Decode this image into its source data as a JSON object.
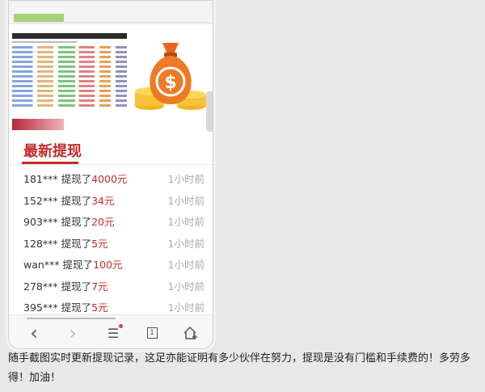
{
  "section_title": "最新提现",
  "withdrawals": [
    {
      "user": "181***",
      "verb": "提现了",
      "amount": "4000元",
      "time": "1小时前"
    },
    {
      "user": "152***",
      "verb": "提现了",
      "amount": "34元",
      "time": "1小时前"
    },
    {
      "user": "903***",
      "verb": "提现了",
      "amount": "20元",
      "time": "1小时前"
    },
    {
      "user": "128***",
      "verb": "提现了",
      "amount": "5元",
      "time": "1小时前"
    },
    {
      "user": "wan***",
      "verb": "提现了",
      "amount": "100元",
      "time": "1小时前"
    },
    {
      "user": "278***",
      "verb": "提现了",
      "amount": "7元",
      "time": "1小时前"
    },
    {
      "user": "395***",
      "verb": "提现了",
      "amount": "5元",
      "time": "1小时前"
    }
  ],
  "banner": {
    "icon": "money-bag-icon",
    "symbol": "$"
  },
  "toolbar": {
    "back_icon": "‹",
    "forward_icon": "›",
    "menu_icon": "☰",
    "tab_count": "1",
    "home_icon": "home-icon"
  },
  "caption": "随手截图实时更新提现记录，这足亦能证明有多少伙伴在努力，提现是没有门槛和手续费的！多劳多得！加油！",
  "colors": {
    "accent": "#c42a2a",
    "time": "#aaaaaa",
    "background": "#e8e8e8"
  }
}
